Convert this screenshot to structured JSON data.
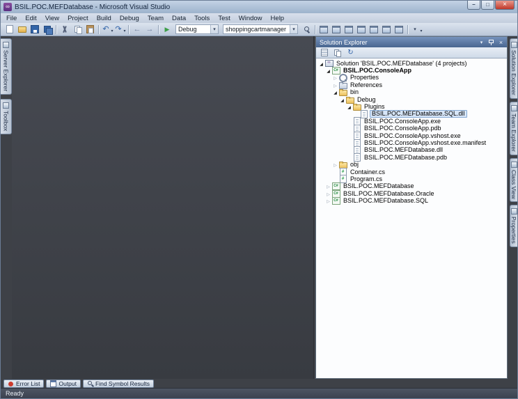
{
  "window": {
    "title": "BSIL.POC.MEFDatabase - Microsoft Visual Studio",
    "buttons": [
      "minimize",
      "maximize",
      "close"
    ]
  },
  "menu": {
    "items": [
      "File",
      "Edit",
      "View",
      "Project",
      "Build",
      "Debug",
      "Team",
      "Data",
      "Tools",
      "Test",
      "Window",
      "Help"
    ]
  },
  "toolbar": {
    "entries": [
      {
        "type": "button",
        "icon": "new-item"
      },
      {
        "type": "button",
        "icon": "open-file"
      },
      {
        "type": "button",
        "icon": "save"
      },
      {
        "type": "button",
        "icon": "save-all"
      },
      {
        "type": "sep"
      },
      {
        "type": "button",
        "icon": "cut"
      },
      {
        "type": "button",
        "icon": "copy"
      },
      {
        "type": "button",
        "icon": "paste"
      },
      {
        "type": "sep"
      },
      {
        "type": "button",
        "icon": "undo",
        "dropdown": true
      },
      {
        "type": "button",
        "icon": "redo",
        "dropdown": true
      },
      {
        "type": "sep"
      },
      {
        "type": "button",
        "icon": "navigate-back"
      },
      {
        "type": "button",
        "icon": "navigate-forward"
      },
      {
        "type": "sep"
      },
      {
        "type": "button",
        "icon": "start-debug"
      },
      {
        "type": "combo",
        "name": "solution-configuration-combo",
        "value": "Debug",
        "width": 62
      },
      {
        "type": "combo",
        "name": "find-combo",
        "value": "shoppingcartmanager",
        "width": 108
      },
      {
        "type": "button",
        "icon": "find"
      },
      {
        "type": "sep"
      },
      {
        "type": "button",
        "icon": "solution-explorer"
      },
      {
        "type": "button",
        "icon": "team-explorer"
      },
      {
        "type": "button",
        "icon": "properties-window"
      },
      {
        "type": "button",
        "icon": "object-browser"
      },
      {
        "type": "button",
        "icon": "error-list-window"
      },
      {
        "type": "button",
        "icon": "output-window"
      },
      {
        "type": "button",
        "icon": "start-page"
      },
      {
        "type": "sep"
      },
      {
        "type": "button",
        "icon": "toolbar-options",
        "dropdown": true
      }
    ]
  },
  "left_tabs": [
    {
      "label": "Server Explorer",
      "icon": "server-explorer-icon"
    },
    {
      "label": "Toolbox",
      "icon": "toolbox-icon"
    }
  ],
  "right_tabs": [
    {
      "label": "Solution Explorer",
      "icon": "solution-explorer-icon"
    },
    {
      "label": "Team Explorer",
      "icon": "team-explorer-icon"
    },
    {
      "label": "Class View",
      "icon": "class-view-icon"
    },
    {
      "label": "Properties",
      "icon": "properties-icon"
    }
  ],
  "solution_explorer": {
    "title": "Solution Explorer",
    "header_buttons": [
      "window-position",
      "auto-hide",
      "close"
    ],
    "toolbar": [
      "properties",
      "show-all-files",
      "refresh"
    ],
    "tree": [
      {
        "label": "Solution 'BSIL.POC.MEFDatabase' (4 projects)",
        "level": 0,
        "icon": "solution",
        "arrow": "expanded"
      },
      {
        "label": "BSIL.POC.ConsoleApp",
        "level": 1,
        "icon": "project",
        "arrow": "expanded",
        "bold": true
      },
      {
        "label": "Properties",
        "level": 2,
        "icon": "properties",
        "arrow": "collapsed"
      },
      {
        "label": "References",
        "level": 2,
        "icon": "references",
        "arrow": "collapsed"
      },
      {
        "label": "bin",
        "level": 2,
        "icon": "folder",
        "arrow": "expanded"
      },
      {
        "label": "Debug",
        "level": 3,
        "icon": "folder",
        "arrow": "expanded"
      },
      {
        "label": "Plugins",
        "level": 4,
        "icon": "folder",
        "arrow": "expanded"
      },
      {
        "label": "BSIL.POC.MEFDatabase.SQL.dll",
        "level": 5,
        "icon": "file",
        "arrow": "none",
        "selected": true
      },
      {
        "label": "BSIL.POC.ConsoleApp.exe",
        "level": 4,
        "icon": "file",
        "arrow": "none"
      },
      {
        "label": "BSIL.POC.ConsoleApp.pdb",
        "level": 4,
        "icon": "file",
        "arrow": "none"
      },
      {
        "label": "BSIL.POC.ConsoleApp.vshost.exe",
        "level": 4,
        "icon": "file",
        "arrow": "none"
      },
      {
        "label": "BSIL.POC.ConsoleApp.vshost.exe.manifest",
        "level": 4,
        "icon": "file",
        "arrow": "none"
      },
      {
        "label": "BSIL.POC.MEFDatabase.dll",
        "level": 4,
        "icon": "file",
        "arrow": "none"
      },
      {
        "label": "BSIL.POC.MEFDatabase.pdb",
        "level": 4,
        "icon": "file",
        "arrow": "none"
      },
      {
        "label": "obj",
        "level": 2,
        "icon": "folder",
        "arrow": "collapsed"
      },
      {
        "label": "Container.cs",
        "level": 2,
        "icon": "cs-file",
        "arrow": "none"
      },
      {
        "label": "Program.cs",
        "level": 2,
        "icon": "cs-file",
        "arrow": "none"
      },
      {
        "label": "BSIL.POC.MEFDatabase",
        "level": 1,
        "icon": "project",
        "arrow": "collapsed"
      },
      {
        "label": "BSIL.POC.MEFDatabase.Oracle",
        "level": 1,
        "icon": "project",
        "arrow": "collapsed"
      },
      {
        "label": "BSIL.POC.MEFDatabase.SQL",
        "level": 1,
        "icon": "project",
        "arrow": "collapsed"
      }
    ]
  },
  "bottom_tabs": [
    {
      "label": "Error List",
      "icon": "error-list"
    },
    {
      "label": "Output",
      "icon": "output"
    },
    {
      "label": "Find Symbol Results",
      "icon": "find-symbol"
    }
  ],
  "status_bar": {
    "text": "Ready"
  },
  "colors": {
    "titlebar": "#b0c2d8",
    "chrome": "#c5d1e2",
    "mdi_background": "#3e4147",
    "panel_header": "#51719f",
    "selection_fill": "#d7e6f8",
    "selection_border": "#84a9d4",
    "close_button": "#c0392b"
  }
}
